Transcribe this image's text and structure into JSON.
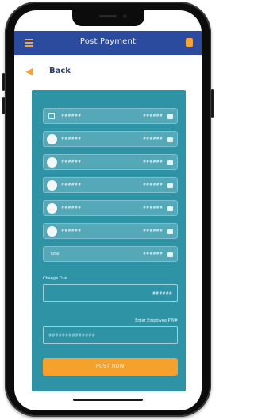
{
  "appbar": {
    "title": "Post Payment"
  },
  "subbar": {
    "back_label": "Back"
  },
  "rows": [
    {
      "kind": "check",
      "name": "######",
      "amount": "######"
    },
    {
      "kind": "radio",
      "name": "######",
      "amount": "######"
    },
    {
      "kind": "radio",
      "name": "######",
      "amount": "######"
    },
    {
      "kind": "radio",
      "name": "######",
      "amount": "######"
    },
    {
      "kind": "radio",
      "name": "######",
      "amount": "######"
    },
    {
      "kind": "radio",
      "name": "######",
      "amount": "######"
    }
  ],
  "total_row": {
    "name": "Total",
    "amount": "######"
  },
  "change_field": {
    "label": "Change Due",
    "value": "######"
  },
  "pin_field": {
    "label": "Enter Employee PIN#",
    "placeholder": "##############"
  },
  "post_button": {
    "label": "POST NOW"
  },
  "colors": {
    "appbar": "#2b4b9e",
    "accent": "#f5a33c",
    "panel": "#2f93a6",
    "button": "#f5a12b"
  }
}
